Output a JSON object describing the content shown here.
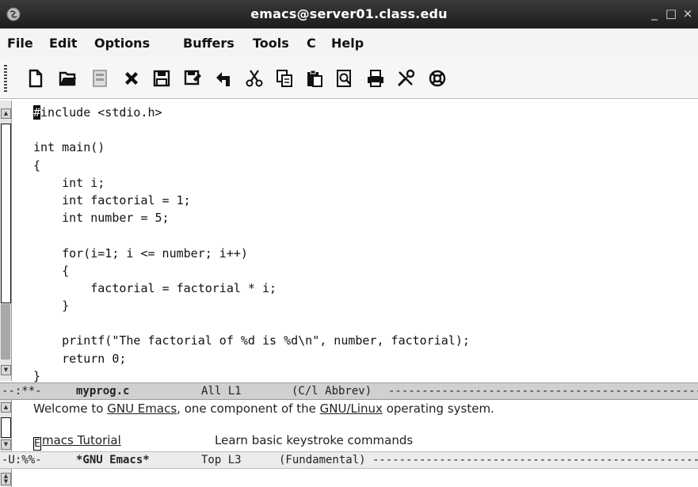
{
  "window": {
    "title": "emacs@server01.class.edu",
    "minimize": "_",
    "maximize": "□",
    "close": "×"
  },
  "menubar": [
    "File",
    "Edit",
    "Options",
    "Buffers",
    "Tools",
    "C",
    "Help"
  ],
  "toolbar": [
    "new-file-icon",
    "open-folder-icon",
    "dired-icon",
    "close-buffer-icon",
    "save-icon",
    "save-as-icon",
    "undo-icon",
    "cut-icon",
    "copy-icon",
    "paste-icon",
    "search-icon",
    "print-icon",
    "preferences-icon",
    "help-icon"
  ],
  "editor": {
    "cursor_char": "#",
    "lines": [
      "include <stdio.h>",
      "",
      "int main()",
      "{",
      "    int i;",
      "    int factorial = 1;",
      "    int number = 5;",
      "",
      "    for(i=1; i <= number; i++)",
      "    {",
      "        factorial = factorial * i;",
      "    }",
      "",
      "    printf(\"The factorial of %d is %d\\n\", number, factorial);",
      "    return 0;",
      "}"
    ]
  },
  "modeline_top": {
    "status": "--:**-",
    "buffer": "myprog.c",
    "position": "All L1",
    "mode": "(C/l Abbrev)",
    "fill": "-------------------------------------------------------"
  },
  "welcome": {
    "prefix": "Welcome to ",
    "link1": "GNU Emacs",
    "middle": ", one component of the ",
    "link2": "GNU/Linux",
    "suffix": " operating system."
  },
  "splash": {
    "link": "macs Tutorial",
    "link_first": "E",
    "description": "Learn basic keystroke commands"
  },
  "modeline_bottom": {
    "status": "-U:%%-",
    "buffer": "*GNU Emacs*",
    "position": "Top L3",
    "mode": "(Fundamental)",
    "fill": "-------------------------------------------------------"
  }
}
